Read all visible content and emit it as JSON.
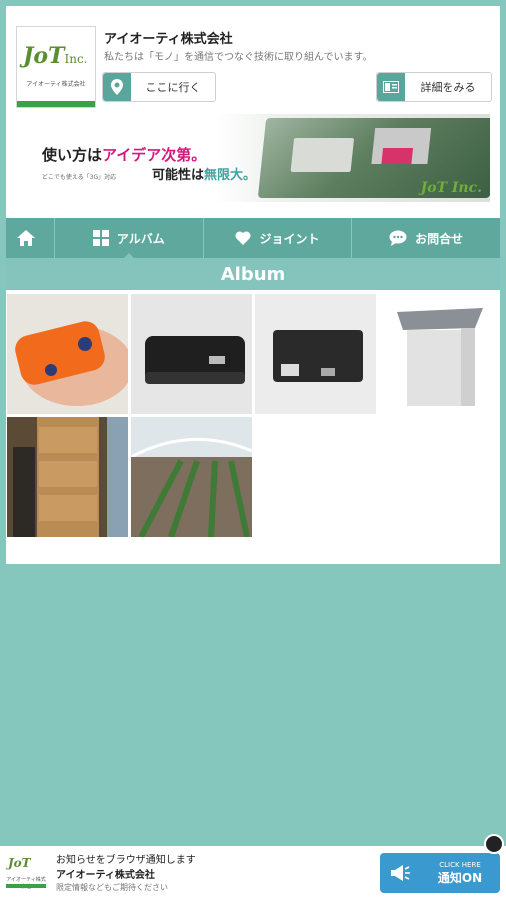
{
  "header": {
    "logo_text": "JoT",
    "logo_suffix": "Inc.",
    "logo_caption": "アイオーティ株式会社",
    "company_name": "アイオーティ株式会社",
    "description": "私たちは「モノ」を通信でつなぐ技術に取り組んでいます。",
    "go_label": "ここに行く",
    "detail_label": "詳細をみる"
  },
  "banner": {
    "line1_prefix": "使い方は",
    "line1_highlight": "アイデア次第。",
    "line2": "どこでも使える「3G」対応",
    "line3_prefix": "可能性は",
    "line3_highlight": "無限大。",
    "logo": "JoT Inc."
  },
  "nav": {
    "album": "アルバム",
    "joint": "ジョイント",
    "contact": "お問合せ"
  },
  "section_title": "Album",
  "footer": {
    "title": "お知らせをブラウザ通知します",
    "company": "アイオーティ株式会社",
    "sub": "限定情報などもご期待ください",
    "btn_small": "CLICK HERE",
    "btn_big": "通知ON"
  },
  "colors": {
    "background": "#85c6bd",
    "nav": "#5ea89e",
    "accent_pink": "#d6187c",
    "notify_blue": "#3a9ad0"
  }
}
